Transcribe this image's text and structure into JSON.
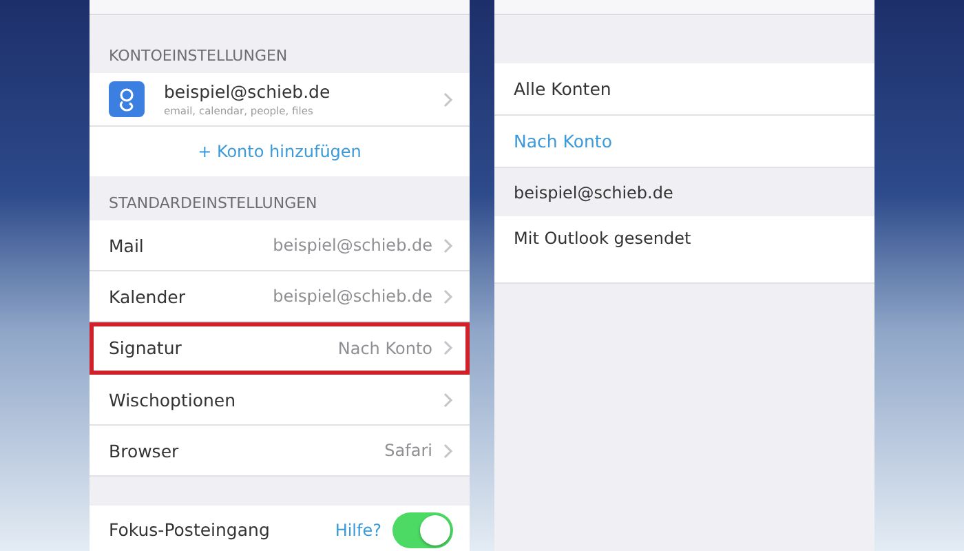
{
  "left_screen": {
    "account_section": {
      "header": "KONTOEINSTELLUNGEN",
      "account": {
        "email": "beispiel@schieb.de",
        "services": "email, calendar, people, files"
      },
      "add_account": "+ Konto hinzufügen"
    },
    "defaults_section": {
      "header": "STANDARDEINSTELLUNGEN",
      "rows": [
        {
          "label": "Mail",
          "value": "beispiel@schieb.de",
          "highlighted": false
        },
        {
          "label": "Kalender",
          "value": "beispiel@schieb.de",
          "highlighted": false
        },
        {
          "label": "Signatur",
          "value": "Nach Konto",
          "highlighted": true
        },
        {
          "label": "Wischoptionen",
          "value": "",
          "highlighted": false
        },
        {
          "label": "Browser",
          "value": "Safari",
          "highlighted": false
        }
      ]
    },
    "focus_row": {
      "label": "Fokus-Posteingang",
      "help": "Hilfe?",
      "on": true
    }
  },
  "right_screen": {
    "options": [
      {
        "label": "Alle Konten",
        "selected": false
      },
      {
        "label": "Nach Konto",
        "selected": true
      }
    ],
    "account_header": "beispiel@schieb.de",
    "signature_text": "Mit Outlook gesendet"
  }
}
